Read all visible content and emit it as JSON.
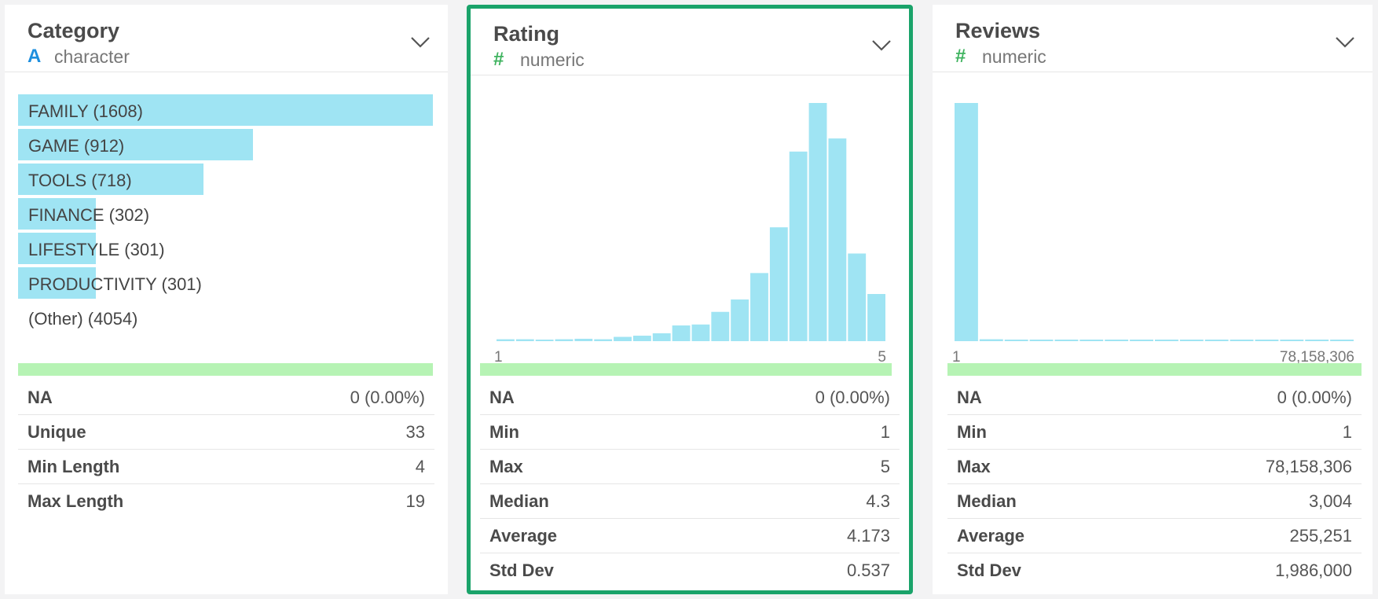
{
  "cards": [
    {
      "name": "Category",
      "type_icon": "A",
      "type": "character",
      "bars": [
        {
          "label": "FAMILY (1608)",
          "count": 1608
        },
        {
          "label": "GAME (912)",
          "count": 912
        },
        {
          "label": "TOOLS (718)",
          "count": 718
        },
        {
          "label": "FINANCE (302)",
          "count": 302
        },
        {
          "label": "LIFESTYLE (301)",
          "count": 301
        },
        {
          "label": "PRODUCTIVITY (301)",
          "count": 301
        },
        {
          "label": "(Other) (4054)",
          "count": 4054
        }
      ],
      "stats": [
        {
          "label": "NA",
          "value": "0 (0.00%)"
        },
        {
          "label": "Unique",
          "value": "33"
        },
        {
          "label": "Min Length",
          "value": "4"
        },
        {
          "label": "Max Length",
          "value": "19"
        }
      ]
    },
    {
      "name": "Rating",
      "type_icon": "#",
      "type": "numeric",
      "selected": true,
      "axis_min": "1",
      "axis_max": "5",
      "stats": [
        {
          "label": "NA",
          "value": "0 (0.00%)"
        },
        {
          "label": "Min",
          "value": "1"
        },
        {
          "label": "Max",
          "value": "5"
        },
        {
          "label": "Median",
          "value": "4.3"
        },
        {
          "label": "Average",
          "value": "4.173"
        },
        {
          "label": "Std Dev",
          "value": "0.537"
        }
      ]
    },
    {
      "name": "Reviews",
      "type_icon": "#",
      "type": "numeric",
      "axis_min": "1",
      "axis_max": "78,158,306",
      "stats": [
        {
          "label": "NA",
          "value": "0 (0.00%)"
        },
        {
          "label": "Min",
          "value": "1"
        },
        {
          "label": "Max",
          "value": "78,158,306"
        },
        {
          "label": "Median",
          "value": "3,004"
        },
        {
          "label": "Average",
          "value": "255,251"
        },
        {
          "label": "Std Dev",
          "value": "1,986,000"
        }
      ]
    }
  ],
  "chart_data": [
    {
      "type": "bar",
      "categories": [
        "FAMILY",
        "GAME",
        "TOOLS",
        "FINANCE",
        "LIFESTYLE",
        "PRODUCTIVITY"
      ],
      "values": [
        1608,
        912,
        718,
        302,
        301,
        301
      ]
    },
    {
      "type": "bar",
      "x": [
        1.1,
        1.3,
        1.5,
        1.7,
        1.9,
        2.1,
        2.3,
        2.5,
        2.7,
        2.9,
        3.1,
        3.3,
        3.5,
        3.7,
        3.9,
        4.1,
        4.3,
        4.5,
        4.7,
        4.9
      ],
      "values": [
        0.8,
        0.8,
        0.6,
        0.8,
        1.0,
        0.8,
        1.8,
        2.3,
        3.3,
        6.6,
        7.0,
        12.3,
        17.5,
        28.6,
        47.8,
        79.6,
        100,
        85.1,
        36.8,
        19.8
      ],
      "xlim": [
        1,
        5
      ]
    },
    {
      "type": "bar",
      "values": [
        100,
        0.8,
        0.6,
        0.6,
        0.6,
        0.6,
        0.6,
        0.6,
        0.6,
        0.6,
        0.6,
        0.6,
        0.6,
        0.6,
        0.6,
        0.6
      ],
      "xlim": [
        1,
        78158306
      ]
    }
  ],
  "colors": {
    "bar": "#9fe4f3",
    "selected_border": "#1aa36a",
    "quality_strip": "#b6f3b4",
    "character_icon": "#1e8fde",
    "numeric_icon": "#3fb35f"
  },
  "icons": {
    "expand": "chevron-down-icon"
  }
}
